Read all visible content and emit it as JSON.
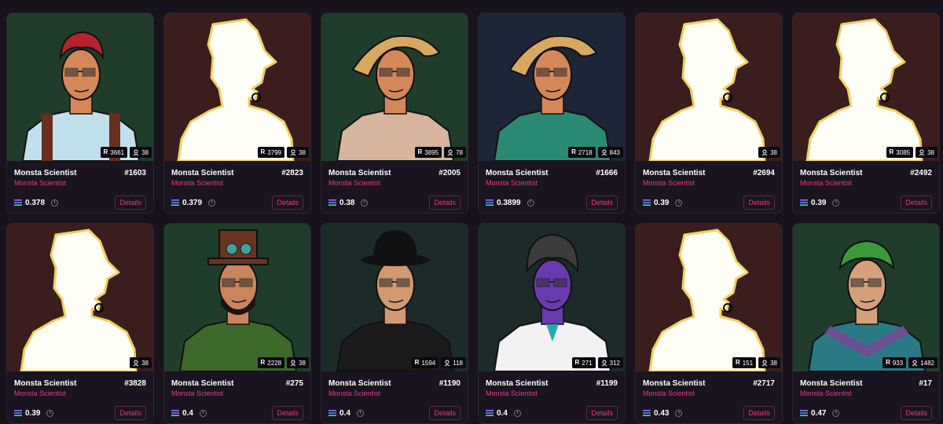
{
  "cards": [
    {
      "name": "Monsta Scientist",
      "number": "#1603",
      "collection": "Monsta Scientist",
      "price": "0.378",
      "rank": "3661",
      "likes": "38",
      "details": "Details",
      "bg": "#1f3d2a",
      "art": "portrait-red-hair"
    },
    {
      "name": "Monsta Scientist",
      "number": "#2823",
      "collection": "Monsta Scientist",
      "price": "0.379",
      "rank": "3799",
      "likes": "38",
      "details": "Details",
      "bg": "#3b1d1e",
      "art": "silhouette"
    },
    {
      "name": "Monsta Scientist",
      "number": "#2005",
      "collection": "Monsta Scientist",
      "price": "0.38",
      "rank": "3895",
      "likes": "78",
      "details": "Details",
      "bg": "#1f3d2a",
      "art": "portrait-straw-hat"
    },
    {
      "name": "Monsta Scientist",
      "number": "#1666",
      "collection": "Monsta Scientist",
      "price": "0.3899",
      "rank": "2718",
      "likes": "843",
      "details": "Details",
      "bg": "#1d2538",
      "art": "portrait-straw-hat-teal"
    },
    {
      "name": "Monsta Scientist",
      "number": "#2694",
      "collection": "Monsta Scientist",
      "price": "0.39",
      "rank": "",
      "likes": "38",
      "details": "Details",
      "bg": "#3b1d1e",
      "art": "silhouette"
    },
    {
      "name": "Monsta Scientist",
      "number": "#2492",
      "collection": "Monsta Scientist",
      "price": "0.39",
      "rank": "3085",
      "likes": "38",
      "details": "Details",
      "bg": "#3b1d1e",
      "art": "silhouette"
    },
    {
      "name": "Monsta Scientist",
      "number": "#3828",
      "collection": "Monsta Scientist",
      "price": "0.39",
      "rank": "",
      "likes": "38",
      "details": "Details",
      "bg": "#3b1d1e",
      "art": "silhouette"
    },
    {
      "name": "Monsta Scientist",
      "number": "#275",
      "collection": "Monsta Scientist",
      "price": "0.4",
      "rank": "2228",
      "likes": "38",
      "details": "Details",
      "bg": "#1f3d2a",
      "art": "portrait-top-hat-goggles"
    },
    {
      "name": "Monsta Scientist",
      "number": "#1190",
      "collection": "Monsta Scientist",
      "price": "0.4",
      "rank": "1594",
      "likes": "118",
      "details": "Details",
      "bg": "#1c2a2a",
      "art": "portrait-bowler"
    },
    {
      "name": "Monsta Scientist",
      "number": "#1199",
      "collection": "Monsta Scientist",
      "price": "0.4",
      "rank": "271",
      "likes": "312",
      "details": "Details",
      "bg": "#1c2a2a",
      "art": "portrait-purple-doctor"
    },
    {
      "name": "Monsta Scientist",
      "number": "#2717",
      "collection": "Monsta Scientist",
      "price": "0.43",
      "rank": "151",
      "likes": "38",
      "details": "Details",
      "bg": "#3b1d1e",
      "art": "silhouette"
    },
    {
      "name": "Monsta Scientist",
      "number": "#17",
      "collection": "Monsta Scientist",
      "price": "0.47",
      "rank": "933",
      "likes": "1482",
      "details": "Details",
      "bg": "#1f3d2a",
      "art": "portrait-laurel"
    }
  ],
  "icons": {
    "rank": "rarity-icon",
    "likes": "owner-icon",
    "price": "solana-icon",
    "info": "info-icon"
  },
  "colors": {
    "accent": "#e83a85",
    "page_bg": "#17121b",
    "card_bg": "#1a1420"
  }
}
